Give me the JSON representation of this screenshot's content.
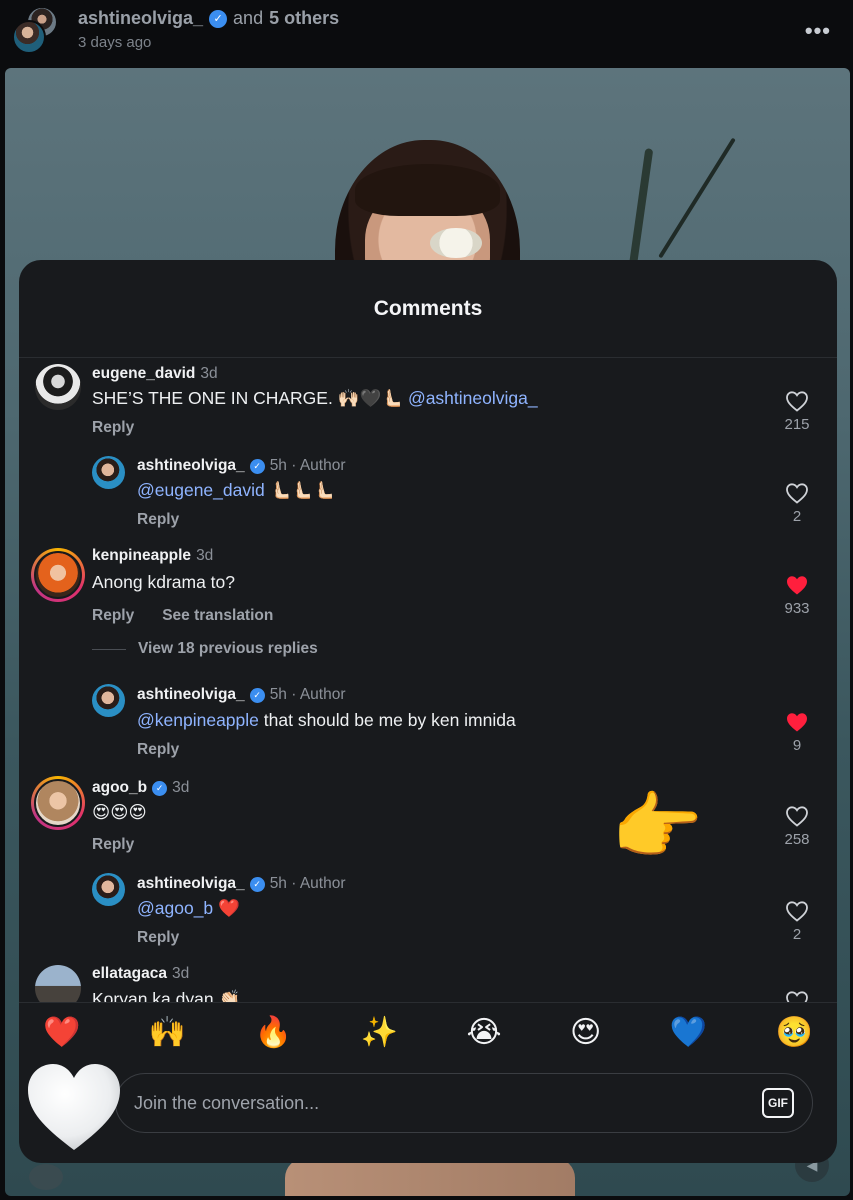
{
  "post_header": {
    "username": "ashtineolviga_",
    "and_text": "and",
    "others_text": "5 others",
    "time": "3 days ago",
    "more_icon": "more-dots-icon"
  },
  "sheet": {
    "title": "Comments"
  },
  "comments": [
    {
      "username": "eugene_david",
      "meta": "3d",
      "text": "SHE’S THE ONE IN CHARGE. 🙌🏻🖤🫷🏻",
      "mention": "@ashtineolviga_",
      "reply_label": "Reply",
      "likes": "215",
      "liked": false
    },
    {
      "username": "ashtineolviga_",
      "meta": "5h · Author",
      "mention": "@eugene_david",
      "text": "🫷🏻🫷🏻🫷🏻",
      "reply_label": "Reply",
      "likes": "2",
      "liked": false
    },
    {
      "username": "kenpineapple",
      "meta": "3d",
      "text": "Anong kdrama to?",
      "reply_label": "Reply",
      "translate_label": "See translation",
      "likes": "933",
      "liked": true
    },
    {
      "view_replies": "View 18 previous replies"
    },
    {
      "username": "ashtineolviga_",
      "meta": "5h · Author",
      "mention": "@kenpineapple",
      "text": "that should be me by ken imnida",
      "reply_label": "Reply",
      "likes": "9",
      "liked": true
    },
    {
      "username": "agoo_b",
      "meta": "3d",
      "text": "😍😍😍",
      "reply_label": "Reply",
      "likes": "258",
      "liked": false
    },
    {
      "username": "ashtineolviga_",
      "meta": "5h · Author",
      "mention": "@agoo_b",
      "text": "❤️",
      "reply_label": "Reply",
      "likes": "2",
      "liked": false
    },
    {
      "username": "ellatagaca",
      "meta": "3d",
      "text": "Koryan ka dyan 👏🏻"
    }
  ],
  "reactions": [
    "❤️",
    "🙌",
    "🔥",
    "✨",
    "😭",
    "😍",
    "💙",
    "🥹"
  ],
  "composer": {
    "placeholder": "Join the conversation...",
    "gif_label": "GIF"
  },
  "overlay": {
    "point_emoji": "👉",
    "heart_emoji": "🤍"
  },
  "colors": {
    "mention": "#8fb4ff",
    "liked_heart": "#ff1f3d",
    "verified": "#3b8ef0",
    "sheet_bg": "#181a1d"
  }
}
